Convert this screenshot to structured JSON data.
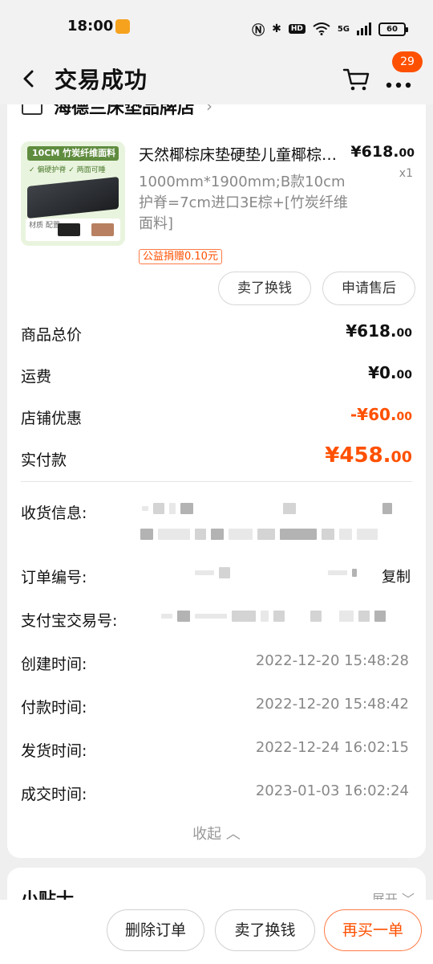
{
  "status_bar": {
    "time": "18:00",
    "network": "5G",
    "hd": "HD",
    "battery": "60"
  },
  "nav": {
    "title": "交易成功",
    "more_badge": "29"
  },
  "shop": {
    "name": "海德兰床垫品牌店"
  },
  "product": {
    "image_header": "10CM 竹炭纤维面料",
    "image_features": "✓ 偏硬护脊   ✓ 两面可睡",
    "image_footer_label": "材质 配置",
    "title": "天然椰棕床垫硬垫儿童椰棕床垫折叠",
    "spec": "1000mm*1900mm;B款10cm护脊=7cm进口3E棕+[竹炭纤维面料]",
    "price_main": "¥618.",
    "price_cents": "00",
    "quantity": "x1",
    "charity_tag": "公益捐赠0.10元",
    "sell_button": "卖了换钱",
    "aftersale_button": "申请售后"
  },
  "summary": {
    "total_label": "商品总价",
    "total_main": "¥618.",
    "total_cents": "00",
    "shipping_label": "运费",
    "shipping_main": "¥0.",
    "shipping_cents": "00",
    "discount_label": "店铺优惠",
    "discount_main": "-¥60.",
    "discount_cents": "00",
    "paid_label": "实付款",
    "paid_main": "¥458.",
    "paid_cents": "00"
  },
  "info": {
    "receiver_label": "收货信息:",
    "order_no_label": "订单编号:",
    "copy_label": "复制",
    "alipay_label": "支付宝交易号:",
    "created_label": "创建时间:",
    "created_value": "2022-12-20 15:48:28",
    "paid_label": "付款时间:",
    "paid_value": "2022-12-20 15:48:42",
    "shipped_label": "发货时间:",
    "shipped_value": "2022-12-24 16:02:15",
    "closed_label": "成交时间:",
    "closed_value": "2023-01-03 16:02:24",
    "collapse_label": "收起 ︿"
  },
  "tips": {
    "title": "小贴士",
    "expand_label": "展开 ﹀"
  },
  "bottom": {
    "delete_label": "删除订单",
    "sell_label": "卖了换钱",
    "rebuy_label": "再买一单"
  },
  "colors": {
    "accent": "#ff5000",
    "background": "#efefef",
    "muted_text": "#888888"
  },
  "icons": [
    "back-arrow-icon",
    "cart-icon",
    "more-dots-icon",
    "shop-icon",
    "chevron-right-icon"
  ]
}
